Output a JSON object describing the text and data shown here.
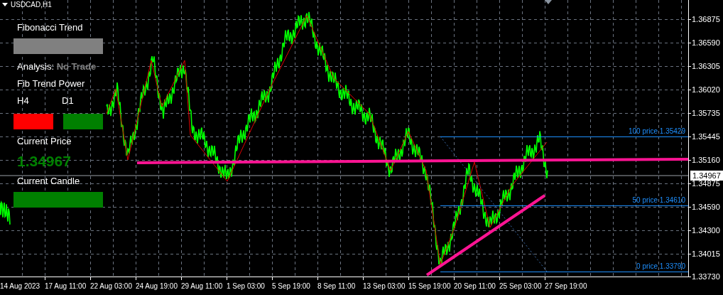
{
  "chart": {
    "symbol": "USDCAD,H1"
  },
  "panel": {
    "title": "Fibonacci Trend",
    "trend_neutral": true,
    "analysis_label": "Analysis:",
    "analysis_value": "No Trade",
    "power_title": "Fib Trend Power",
    "timeframes": [
      {
        "label": "H4",
        "color": "#ff0000"
      },
      {
        "label": "D1",
        "color": "#008000"
      }
    ],
    "price_label": "Current Price",
    "price_value": "1.34967",
    "candle_label": "Current Candle",
    "candle_bullish": true
  },
  "fib_levels": [
    {
      "label": "100 price 1.35429"
    },
    {
      "label": "50 price 1.34610"
    },
    {
      "label": "0 price 1.33790"
    }
  ],
  "price_axis": [
    "1.36875",
    "1.36590",
    "1.36305",
    "1.36020",
    "1.35735",
    "1.35445",
    "1.35160",
    "1.34875",
    "1.34590",
    "1.34300",
    "1.34015",
    "1.33730"
  ],
  "current_price_tag": "1.34967",
  "time_axis": [
    "14 Aug 2023",
    "17 Aug 11:00",
    "22 Aug 03:00",
    "24 Aug 19:00",
    "29 Aug 11:00",
    "1 Sep 03:00",
    "5 Sep 19:00",
    "8 Sep 11:00",
    "13 Sep 03:00",
    "15 Sep 19:00",
    "20 Sep 11:00",
    "25 Sep 03:00",
    "27 Sep 19:00"
  ]
}
